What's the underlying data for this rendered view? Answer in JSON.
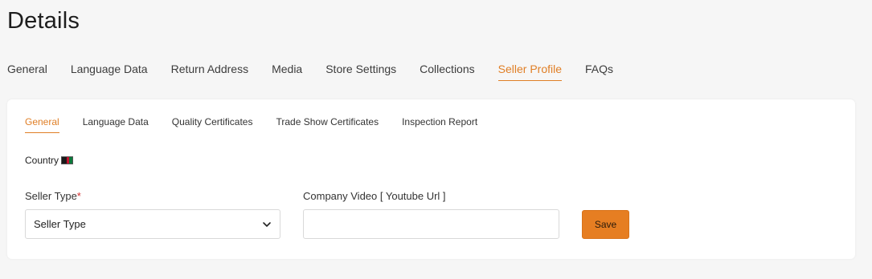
{
  "page": {
    "title": "Details"
  },
  "top_tabs": [
    {
      "label": "General",
      "active": false
    },
    {
      "label": "Language Data",
      "active": false
    },
    {
      "label": "Return Address",
      "active": false
    },
    {
      "label": "Media",
      "active": false
    },
    {
      "label": "Store Settings",
      "active": false
    },
    {
      "label": "Collections",
      "active": false
    },
    {
      "label": "Seller Profile",
      "active": true
    },
    {
      "label": "FAQs",
      "active": false
    }
  ],
  "sub_tabs": [
    {
      "label": "General",
      "active": true
    },
    {
      "label": "Language Data",
      "active": false
    },
    {
      "label": "Quality Certificates",
      "active": false
    },
    {
      "label": "Trade Show Certificates",
      "active": false
    },
    {
      "label": "Inspection Report",
      "active": false
    }
  ],
  "country": {
    "label": "Country",
    "flag_icon": "flag-icon"
  },
  "form": {
    "seller_type_label": "Seller Type",
    "required_mark": "*",
    "seller_type_value": "Seller Type",
    "company_video_label": "Company Video [ Youtube Url ]",
    "company_video_value": "",
    "save_label": "Save"
  },
  "colors": {
    "accent": "#e07f26",
    "button": "#e67e22",
    "background": "#f6f6f6",
    "card": "#ffffff"
  }
}
